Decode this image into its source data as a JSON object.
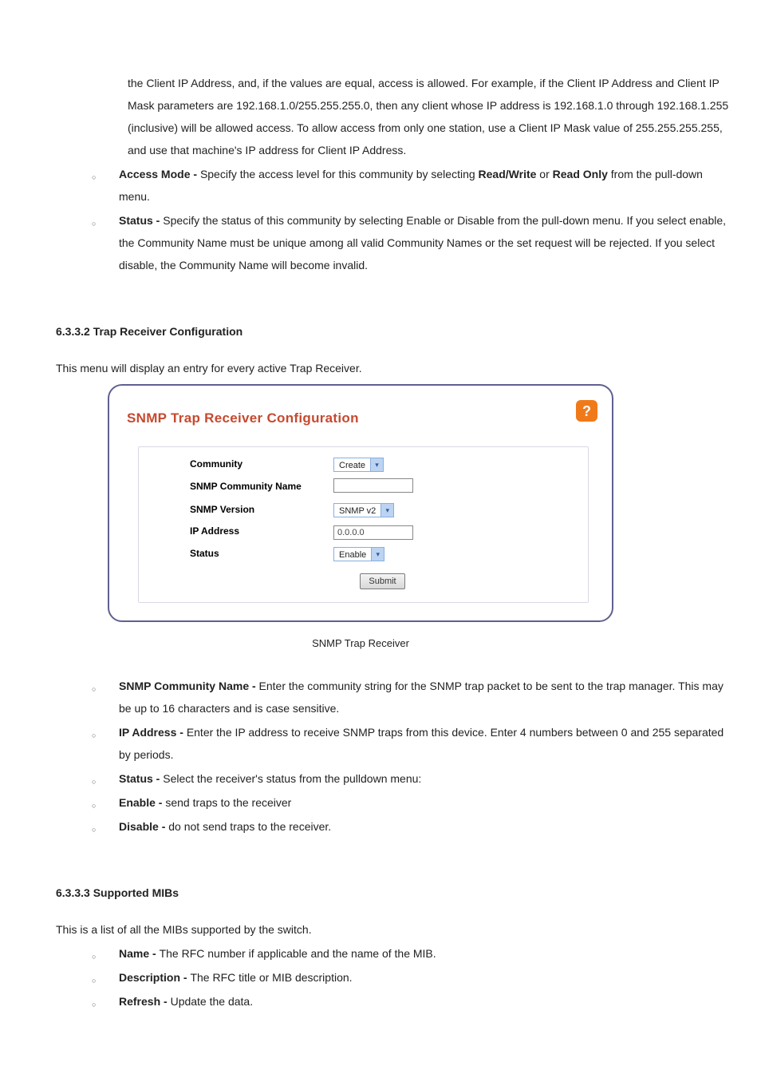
{
  "block1": {
    "cont": "the Client IP Address, and, if the values are equal, access is allowed. For example, if the Client IP Address and Client IP Mask parameters are 192.168.1.0/255.255.255.0, then any client whose IP address is 192.168.1.0 through 192.168.1.255 (inclusive) will be allowed access. To allow access from only one station, use a Client IP Mask value of 255.255.255.255, and use that machine's IP address for Client IP Address."
  },
  "bullets1": {
    "b1": {
      "term": "Access Mode - ",
      "text_a": "Specify the access level for this community by selecting ",
      "term_ro": "Read/Write",
      "text_or": " or ",
      "term_rw": "Read Only",
      "text_b": " from the pull-down menu."
    },
    "b2": {
      "term": "Status - ",
      "text": "Specify the status of this community by selecting Enable or Disable from the pull-down menu. If you select enable, the Community Name must be unique among all valid Community Names or the set request will be rejected. If you select disable, the Community Name will become invalid."
    }
  },
  "sec_trap": {
    "title": "6.3.3.2 Trap Receiver Configuration",
    "intro": "This menu will display an entry for every active Trap Receiver.",
    "caption": "SNMP Trap Receiver"
  },
  "panel": {
    "title": "SNMP Trap Receiver Configuration",
    "help": "?",
    "labels": {
      "community": "Community",
      "snmp_name": "SNMP Community Name",
      "snmp_ver": "SNMP Version",
      "ip": "IP Address",
      "status": "Status"
    },
    "values": {
      "community_sel": "Create",
      "snmp_name_val": "",
      "snmp_ver_sel": "SNMP v2",
      "ip_val": "0.0.0.0",
      "status_sel": "Enable"
    },
    "submit_label": "Submit"
  },
  "bullets2": {
    "b1": {
      "term": "SNMP Community Name - ",
      "text": "Enter the community string for the SNMP trap packet to be sent to the trap manager. This may be up to 16 characters and is case sensitive."
    },
    "b2": {
      "term": "IP Address - ",
      "text": "Enter the IP address to receive SNMP traps from this device. Enter 4 numbers between 0 and 255 separated by periods."
    },
    "b3": {
      "term": "Status - ",
      "text": "Select the receiver's status from the pulldown menu:"
    },
    "b4": {
      "term": "Enable - ",
      "text": "send traps to the receiver"
    },
    "b5": {
      "term": "Disable - ",
      "text": "do not send traps to the receiver."
    }
  },
  "sec_mib": {
    "title": "6.3.3.3 Supported MIBs",
    "intro": "This is a list of all the MIBs supported by the switch."
  },
  "bullets3": {
    "b1": {
      "term": "Name - ",
      "text": "The RFC number if applicable and the name of the MIB."
    },
    "b2": {
      "term": "Description - ",
      "text": "The RFC title or MIB description."
    },
    "b3": {
      "term": "Refresh - ",
      "text": "Update the data."
    }
  }
}
